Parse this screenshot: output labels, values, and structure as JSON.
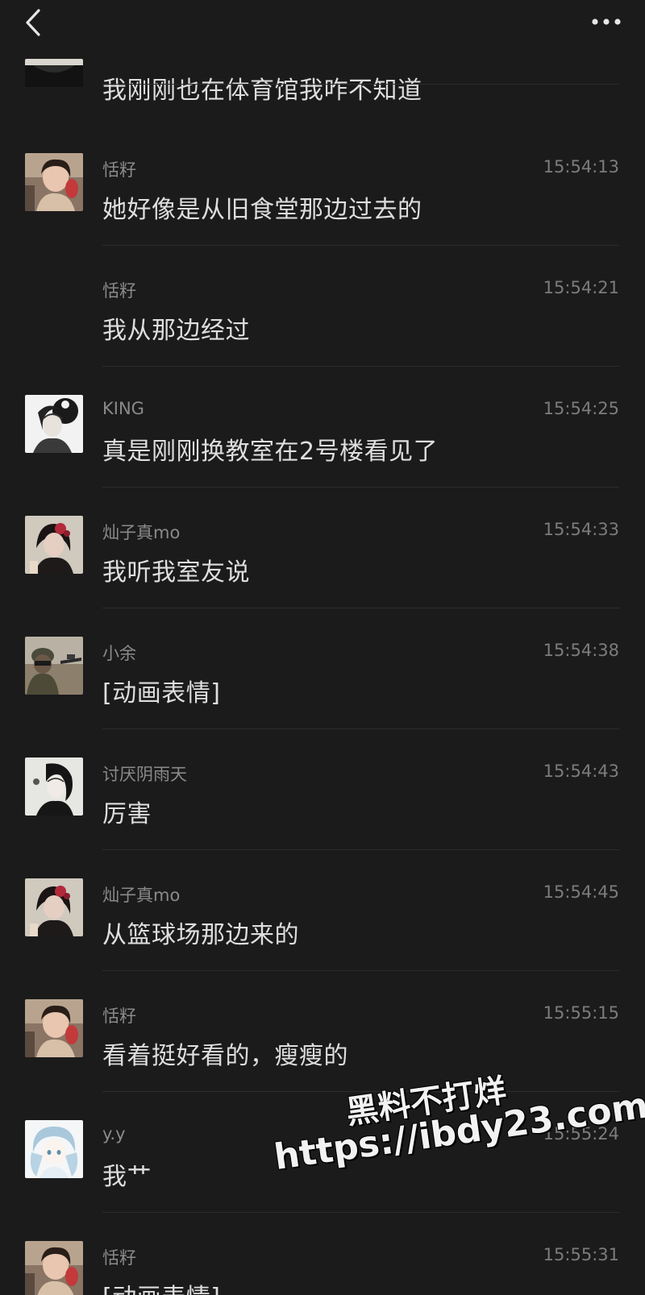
{
  "header": {
    "back_icon": "chevron-left-icon",
    "more_icon": "more-horizontal-icon"
  },
  "messages": [
    {
      "name": "",
      "time": "",
      "text": "我刚刚也在体育馆我咋不知道",
      "avatar": "avatar-dark-partial"
    },
    {
      "name": "恬籽",
      "time": "15:54:13",
      "text": "她好像是从旧食堂那边过去的",
      "avatar": "avatar-girl-photo"
    },
    {
      "name": "恬籽",
      "time": "15:54:21",
      "text": "我从那边经过",
      "avatar": ""
    },
    {
      "name": "KING",
      "time": "15:54:25",
      "text": "真是刚刚换教室在2号楼看见了",
      "avatar": "avatar-sketch-portrait"
    },
    {
      "name": "灿子真mo",
      "time": "15:54:33",
      "text": "我听我室友说",
      "avatar": "avatar-girl-flower"
    },
    {
      "name": "小余",
      "time": "15:54:38",
      "text": "[动画表情]",
      "avatar": "avatar-soldier"
    },
    {
      "name": "讨厌阴雨天",
      "time": "15:54:43",
      "text": "厉害",
      "avatar": "avatar-sketch-dark-hair"
    },
    {
      "name": "灿子真mo",
      "time": "15:54:45",
      "text": "从篮球场那边来的",
      "avatar": "avatar-girl-flower"
    },
    {
      "name": "恬籽",
      "time": "15:55:15",
      "text": "看着挺好看的，瘦瘦的",
      "avatar": "avatar-girl-photo"
    },
    {
      "name": "y.y",
      "time": "15:55:24",
      "text": "我艹",
      "avatar": "avatar-anime-blue-hair"
    },
    {
      "name": "恬籽",
      "time": "15:55:31",
      "text": "[动画表情]",
      "avatar": "avatar-girl-photo"
    }
  ],
  "watermark": {
    "line1": "黑料不打烊",
    "line2": "https://ibdy23.com"
  }
}
